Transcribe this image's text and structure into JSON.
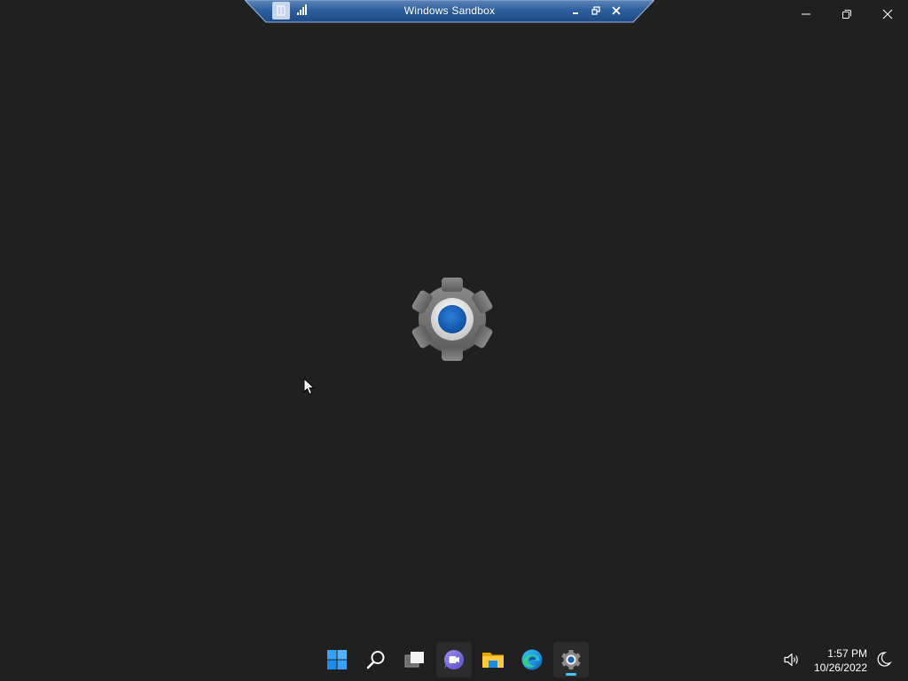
{
  "connection_bar": {
    "title": "Windows Sandbox",
    "icons": [
      "pin-icon",
      "signal-icon",
      "minimize-icon",
      "restore-icon",
      "close-icon"
    ]
  },
  "window_controls": {
    "icons": [
      "minimize-icon",
      "restore-icon",
      "close-icon"
    ]
  },
  "splash": {
    "icon": "settings-gear-icon",
    "accent_color": "#1a5fb4"
  },
  "taskbar": {
    "apps": [
      {
        "name": "start",
        "icon": "windows-start-icon"
      },
      {
        "name": "search",
        "icon": "search-icon"
      },
      {
        "name": "task-view",
        "icon": "task-view-icon"
      },
      {
        "name": "chat",
        "icon": "teams-chat-icon"
      },
      {
        "name": "file-explorer",
        "icon": "folder-icon"
      },
      {
        "name": "edge",
        "icon": "edge-icon"
      },
      {
        "name": "settings",
        "icon": "settings-icon",
        "active": true
      }
    ],
    "tray": {
      "volume_icon": "volume-icon",
      "time": "1:57 PM",
      "date": "10/26/2022",
      "focus_icon": "moon-icon"
    },
    "accent_color": "#4cc2ff"
  }
}
